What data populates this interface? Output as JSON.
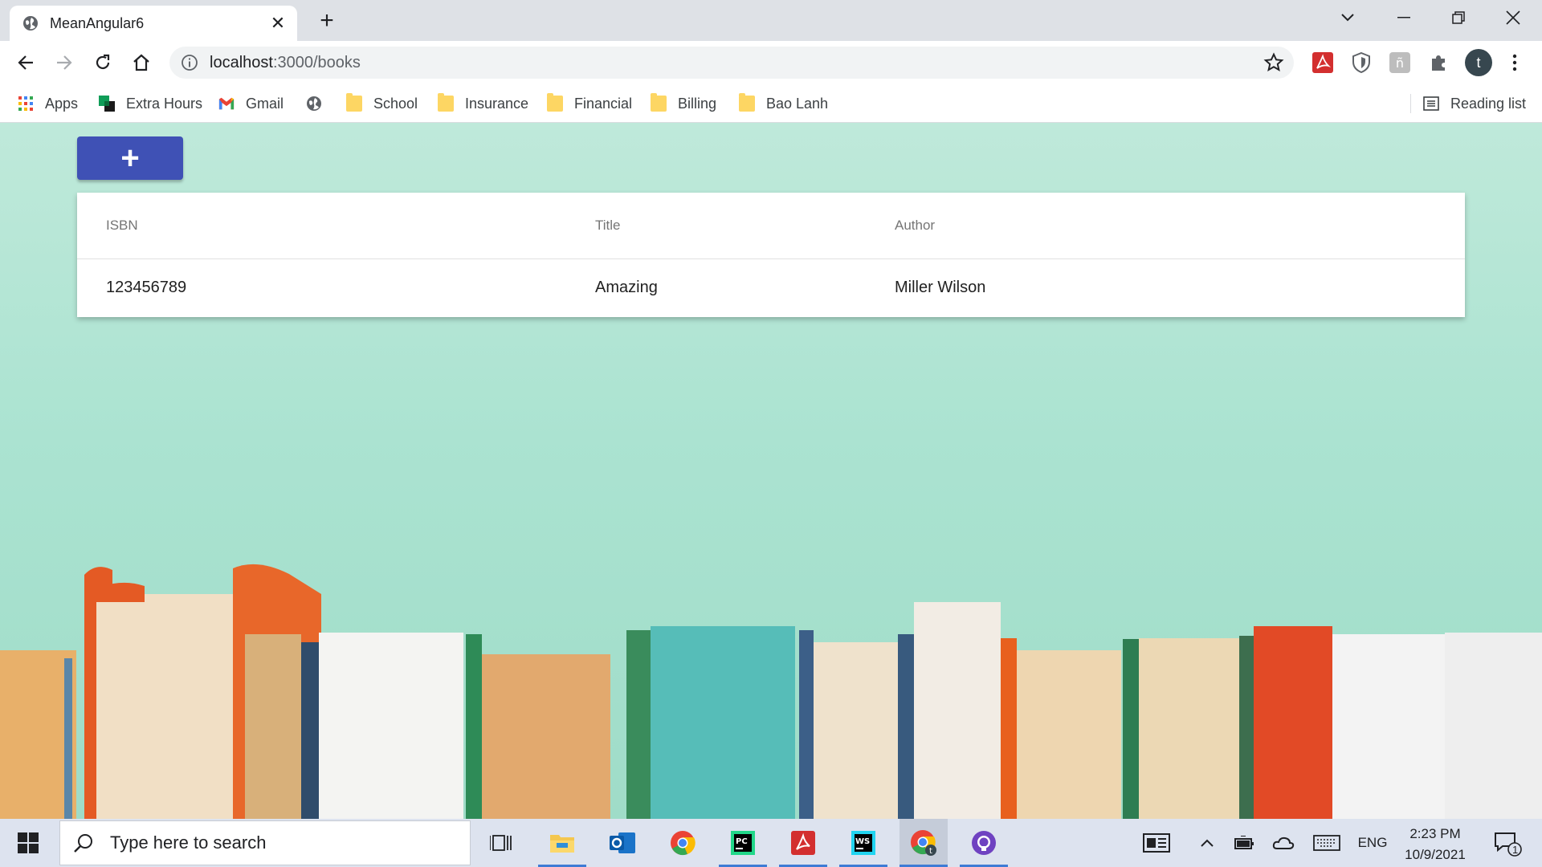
{
  "browser": {
    "tab_title": "MeanAngular6",
    "url_host": "localhost",
    "url_path": ":3000/books",
    "bookmarks": [
      {
        "label": "Apps",
        "icon": "apps-grid-icon"
      },
      {
        "label": "Extra Hours",
        "icon": "extra-hours-icon"
      },
      {
        "label": "Gmail",
        "icon": "gmail-icon"
      },
      {
        "label": "",
        "icon": "globe-icon"
      },
      {
        "label": "School",
        "icon": "folder-icon"
      },
      {
        "label": "Insurance",
        "icon": "folder-icon"
      },
      {
        "label": "Financial",
        "icon": "folder-icon"
      },
      {
        "label": "Billing",
        "icon": "folder-icon"
      },
      {
        "label": "Bao Lanh",
        "icon": "folder-icon"
      }
    ],
    "reading_list": "Reading list",
    "profile_initial": "t"
  },
  "page": {
    "add_button_label": "+",
    "table": {
      "columns": [
        "ISBN",
        "Title",
        "Author"
      ],
      "rows": [
        [
          "123456789",
          "Amazing",
          "Miller Wilson"
        ]
      ]
    }
  },
  "taskbar": {
    "search_placeholder": "Type here to search",
    "language": "ENG",
    "time": "2:23 PM",
    "date": "10/9/2021",
    "notification_count": "1"
  },
  "colors": {
    "primary": "#3f51b5",
    "page_bg": "#abe3d1"
  }
}
